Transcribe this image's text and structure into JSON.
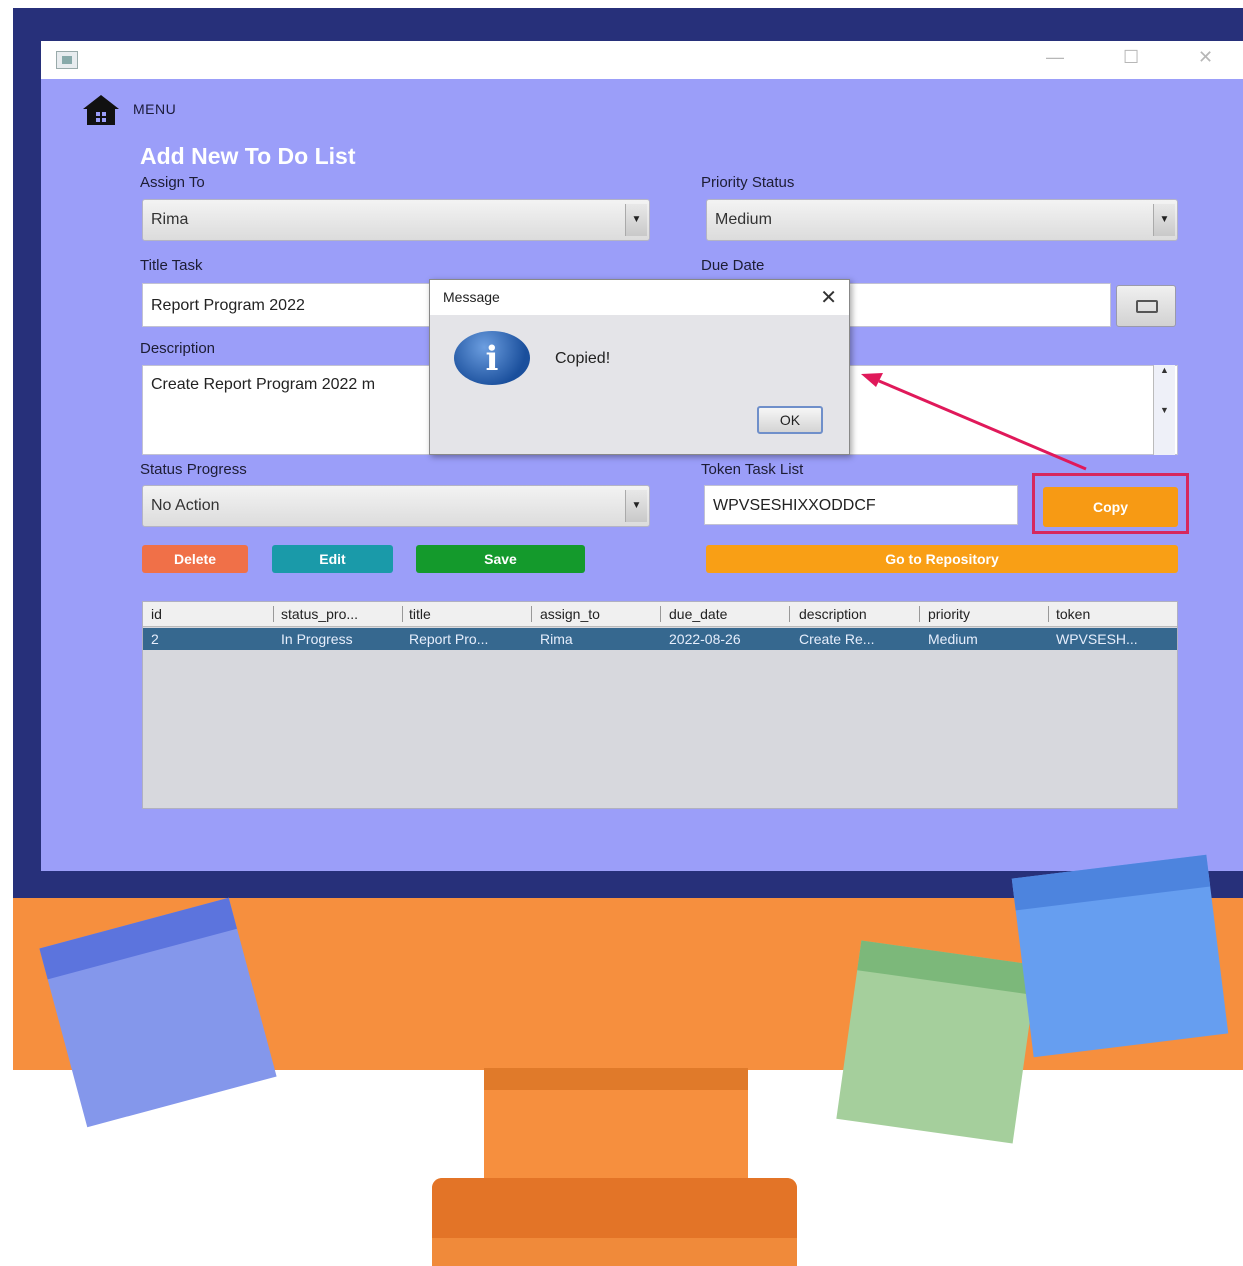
{
  "window": {
    "controls": {
      "minimize": "—",
      "maximize": "☐",
      "close": "✕"
    }
  },
  "menu": {
    "label": "MENU",
    "icon": "home-icon"
  },
  "form": {
    "heading": "Add New To Do List",
    "assign_to": {
      "label": "Assign To",
      "value": "Rima"
    },
    "priority": {
      "label": "Priority Status",
      "value": "Medium"
    },
    "title_task": {
      "label": "Title Task",
      "value": "Report Program 2022"
    },
    "due_date": {
      "label": "Due Date",
      "value": ""
    },
    "description": {
      "label": "Description",
      "value": "Create Report Program 2022 m"
    },
    "status": {
      "label": "Status Progress",
      "value": "No Action"
    },
    "token": {
      "label": "Token Task List",
      "value": "WPVSESHIXXODDCF"
    }
  },
  "buttons": {
    "delete": "Delete",
    "edit": "Edit",
    "save": "Save",
    "copy": "Copy",
    "repository": "Go to Repository"
  },
  "table": {
    "columns": [
      "id",
      "status_pro...",
      "title",
      "assign_to",
      "due_date",
      "description",
      "priority",
      "token"
    ],
    "rows": [
      [
        "2",
        "In Progress",
        "Report Pro...",
        "Rima",
        "2022-08-26",
        "Create Re...",
        "Medium",
        "WPVSESH..."
      ]
    ]
  },
  "dialog": {
    "title": "Message",
    "message": "Copied!",
    "ok": "OK",
    "icon": "info-icon"
  },
  "colors": {
    "window_bg": "#9b9ef9",
    "accent_orange": "#f99f15",
    "delete": "#f07048",
    "edit": "#1a9aa9",
    "save": "#149a2c",
    "highlight": "#d6285e",
    "selected_row": "#36688f"
  }
}
